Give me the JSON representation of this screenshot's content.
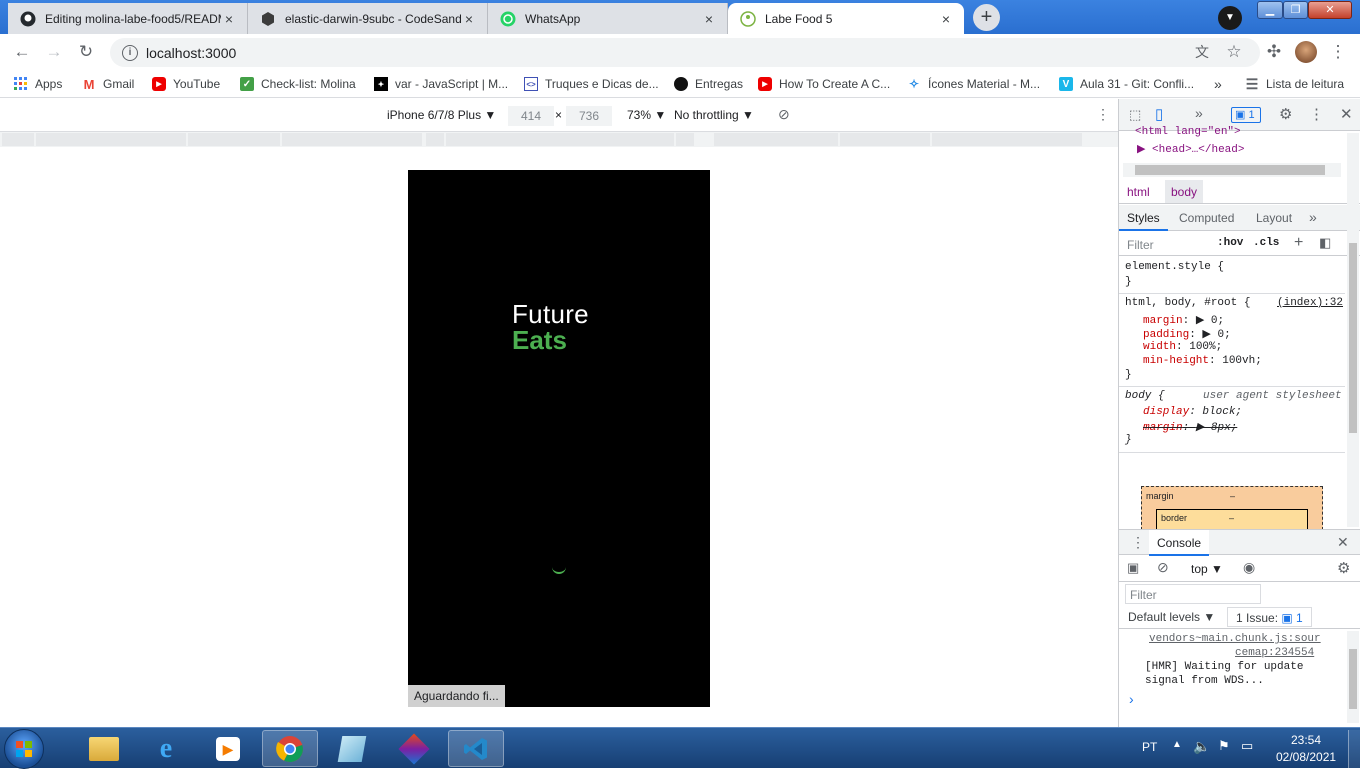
{
  "tabs": [
    {
      "label": "Editing molina-labe-food5/README",
      "icon": "github-icon",
      "active": false
    },
    {
      "label": "elastic-darwin-9subc - CodeSandbox",
      "icon": "codesandbox-icon",
      "active": false
    },
    {
      "label": "WhatsApp",
      "icon": "whatsapp-icon",
      "active": false
    },
    {
      "label": "Labe Food 5",
      "icon": "labefood-icon",
      "active": true
    }
  ],
  "tab_close": "×",
  "new_tab": "+",
  "address": {
    "url": "localhost:3000"
  },
  "bookmarks": [
    {
      "label": "Apps",
      "icon": "apps-grid-icon"
    },
    {
      "label": "Gmail",
      "icon": "gmail-icon"
    },
    {
      "label": "YouTube",
      "icon": "youtube-icon"
    },
    {
      "label": "Check-list: Molina",
      "icon": "checkmark-icon"
    },
    {
      "label": "var - JavaScript | M...",
      "icon": "mdn-icon"
    },
    {
      "label": "Truques e Dicas de...",
      "icon": "code-icon"
    },
    {
      "label": "Entregas",
      "icon": "circle-icon"
    },
    {
      "label": "How To Create A C...",
      "icon": "youtube-icon"
    },
    {
      "label": "Ícones Material - M...",
      "icon": "material-icon"
    },
    {
      "label": "Aula 31 - Git: Confli...",
      "icon": "vimeo-icon"
    }
  ],
  "bookmarks_more": "»",
  "reading_list": "Lista de leitura",
  "device_toolbar": {
    "device": "iPhone 6/7/8 Plus",
    "width": "414",
    "times": "×",
    "height": "736",
    "zoom": "73%",
    "throttling": "No throttling"
  },
  "app": {
    "logo_line1": "Future",
    "logo_line2": "Eats",
    "status_text": "Aguardando fi..."
  },
  "devtools": {
    "issues_count": "1",
    "elements": [
      "<html lang=\"en\">",
      "▶ <head>…</head>"
    ],
    "breadcrumbs": [
      "html",
      "body"
    ],
    "style_tabs": [
      "Styles",
      "Computed",
      "Layout"
    ],
    "filter_placeholder": "Filter",
    "hov": ":hov",
    "cls": ".cls",
    "element_style": "element.style {",
    "close_brace": "}",
    "rule1_selector": "html, body, #root {",
    "rule1_source": "(index):32",
    "rule1_props": [
      {
        "name": "margin",
        "value": "▶ 0;"
      },
      {
        "name": "padding",
        "value": "▶ 0;"
      },
      {
        "name": "width",
        "value": "100%;"
      },
      {
        "name": "min-height",
        "value": "100vh;"
      }
    ],
    "rule2_selector": "body {",
    "rule2_source": "user agent stylesheet",
    "rule2_props": [
      {
        "name": "display",
        "value": "block;"
      },
      {
        "name": "margin",
        "value": "▶ 8px;"
      }
    ],
    "box_margin": "margin",
    "box_border": "border",
    "box_dash": "–",
    "console_title": "Console",
    "console_context": "top",
    "console_filter": "Filter",
    "console_levels": "Default levels",
    "console_issue": "1 Issue:",
    "console_issue_count": "1",
    "console_source1": "vendors~main.chunk.js:sour",
    "console_source2": "cemap:234554",
    "console_msg1": "[HMR] Waiting for update",
    "console_msg2": "signal from WDS...",
    "console_prompt": "›"
  },
  "taskbar": {
    "lang": "PT",
    "time": "23:54",
    "date": "02/08/2021"
  },
  "colors": {
    "logo_green": "#4caf50",
    "accent_blue": "#1a73e8"
  }
}
